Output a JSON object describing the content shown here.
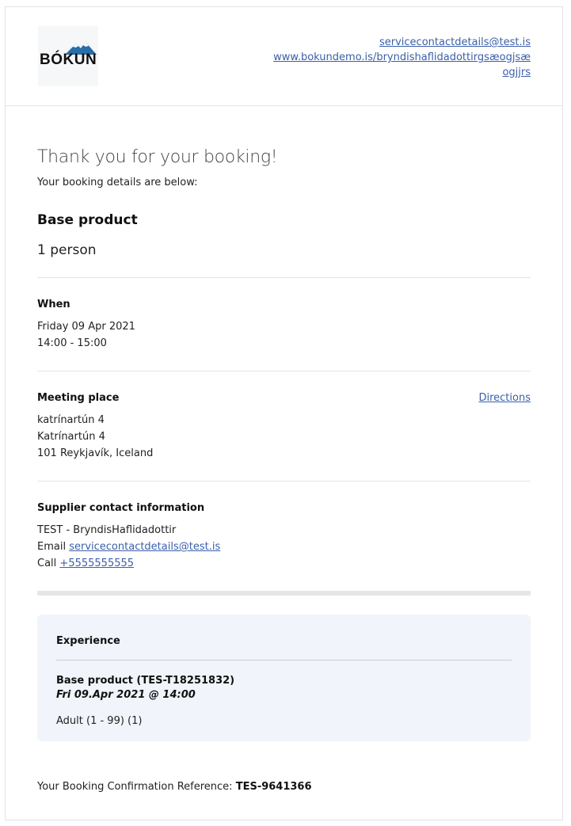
{
  "header": {
    "logo_text": "BÓKUN",
    "contact_email": "servicecontactdetails@test.is",
    "website": "www.bokundemo.is/bryndishaflidadottirgsæogjsæogjjrs"
  },
  "greeting": {
    "title": "Thank you for your booking!",
    "subtitle": "Your booking details are below:"
  },
  "booking": {
    "product": "Base product",
    "persons": "1 person"
  },
  "when": {
    "title": "When",
    "date": "Friday 09 Apr 2021",
    "time": "14:00 - 15:00"
  },
  "meeting": {
    "title": "Meeting place",
    "directions_label": "Directions",
    "line1": "katrínartún 4",
    "line2": "Katrínartún 4",
    "line3": "101 Reykjavík, Iceland"
  },
  "supplier": {
    "title": "Supplier contact information",
    "name": "TEST - BryndisHaflidadottir",
    "email_prefix": "Email",
    "email": "servicecontactdetails@test.is",
    "call_prefix": "Call",
    "phone": "+5555555555"
  },
  "experience": {
    "title": "Experience",
    "product": "Base product (TES-T18251832)",
    "date": "Fri 09.Apr 2021 @ 14:00",
    "pax": "Adult (1 - 99) (1)"
  },
  "reference": {
    "label": "Your Booking Confirmation Reference:",
    "value": "TES-9641366"
  },
  "colors": {
    "link": "#3b5fa8",
    "experience_bg": "#f1f4fa",
    "logo_mountain": "#2a6ea8"
  }
}
